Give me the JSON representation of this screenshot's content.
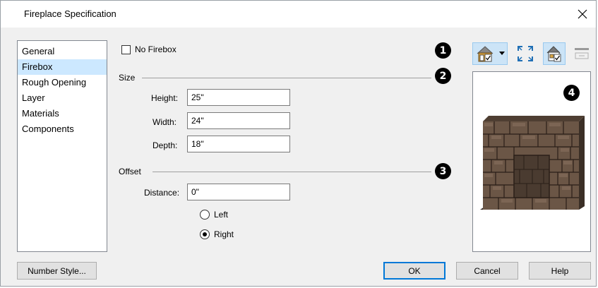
{
  "window": {
    "title": "Fireplace Specification"
  },
  "sidebar": {
    "items": [
      {
        "label": "General"
      },
      {
        "label": "Firebox"
      },
      {
        "label": "Rough Opening"
      },
      {
        "label": "Layer"
      },
      {
        "label": "Materials"
      },
      {
        "label": "Components"
      }
    ],
    "selected_index": 1
  },
  "no_firebox": {
    "label": "No Firebox",
    "checked": false
  },
  "size": {
    "heading": "Size",
    "height_label": "Height:",
    "height_value": "25\"",
    "width_label": "Width:",
    "width_value": "24\"",
    "depth_label": "Depth:",
    "depth_value": "18\""
  },
  "offset": {
    "heading": "Offset",
    "distance_label": "Distance:",
    "distance_value": "0\"",
    "left_label": "Left",
    "right_label": "Right",
    "selected": "Right"
  },
  "callouts": [
    "1",
    "2",
    "3",
    "4"
  ],
  "toolbar": {
    "icons": [
      "3d-view-options-icon",
      "dropdown-arrow-icon",
      "fill-window-icon",
      "render-toggle-icon",
      "plane-view-icon"
    ]
  },
  "buttons": {
    "number_style": "Number Style...",
    "ok": "OK",
    "cancel": "Cancel",
    "help": "Help"
  },
  "colors": {
    "selection": "#cce8ff",
    "default_button_border": "#0078d7",
    "stone": "#6b5646"
  }
}
